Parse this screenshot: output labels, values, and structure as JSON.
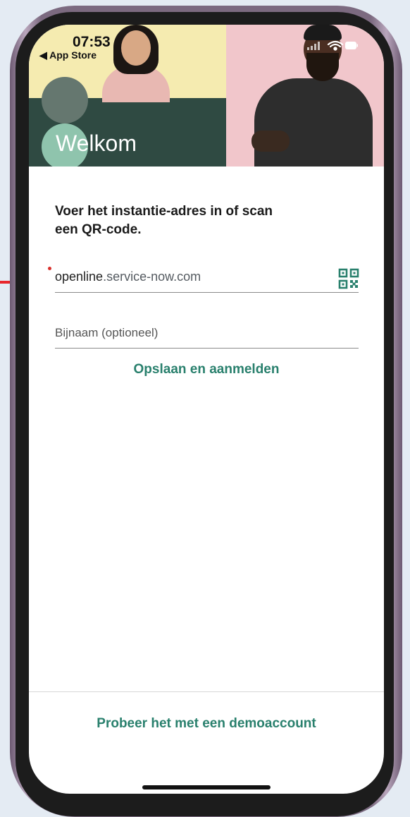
{
  "status_bar": {
    "time": "07:53",
    "back_label": "◀ App Store"
  },
  "hero": {
    "title": "Welkom"
  },
  "form": {
    "instruction": "Voer het instantie-adres in of scan een QR-code.",
    "instance": {
      "value_prefix": "openline",
      "value_suffix": ".service-now.com"
    },
    "nickname": {
      "placeholder": "Bijnaam (optioneel)"
    },
    "save_label": "Opslaan en aanmelden"
  },
  "footer": {
    "demo_label": "Probeer het met een demoaccount"
  },
  "colors": {
    "accent": "#29806d",
    "hero_dark": "#2f4a42",
    "hero_yellow": "#f5ebb0",
    "hero_pink": "#f1c6cb",
    "annotation_arrow": "#e8262b"
  }
}
